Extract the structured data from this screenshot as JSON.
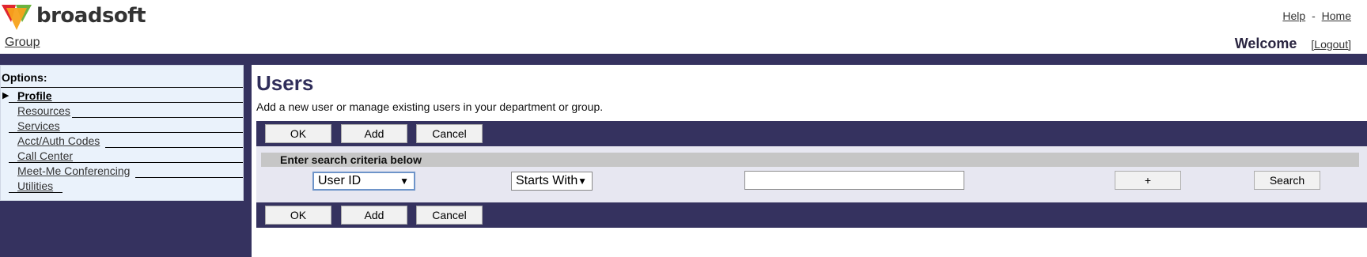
{
  "brand": {
    "name": "broadsoft"
  },
  "header": {
    "help_label": "Help",
    "separator": "-",
    "home_label": "Home",
    "group_label": "Group",
    "welcome_label": "Welcome",
    "logout_label": "[Logout]"
  },
  "sidebar": {
    "title": "Options:",
    "items": [
      {
        "label": "Profile",
        "active": true
      },
      {
        "label": "Resources"
      },
      {
        "label": "Services"
      },
      {
        "label": "Acct/Auth Codes"
      },
      {
        "label": "Call Center"
      },
      {
        "label": "Meet-Me Conferencing"
      },
      {
        "label": "Utilities"
      }
    ]
  },
  "main": {
    "title": "Users",
    "description": "Add a new user or manage existing users in your department or group."
  },
  "buttons": {
    "ok": "OK",
    "add": "Add",
    "cancel": "Cancel"
  },
  "search": {
    "header": "Enter search criteria below",
    "field_select": "User ID",
    "mode_select": "Starts With",
    "value": "",
    "plus_label": "+",
    "search_label": "Search"
  },
  "colors": {
    "bar": "#35325f",
    "panel": "#eaf2fb",
    "title": "#2f2d5a"
  }
}
